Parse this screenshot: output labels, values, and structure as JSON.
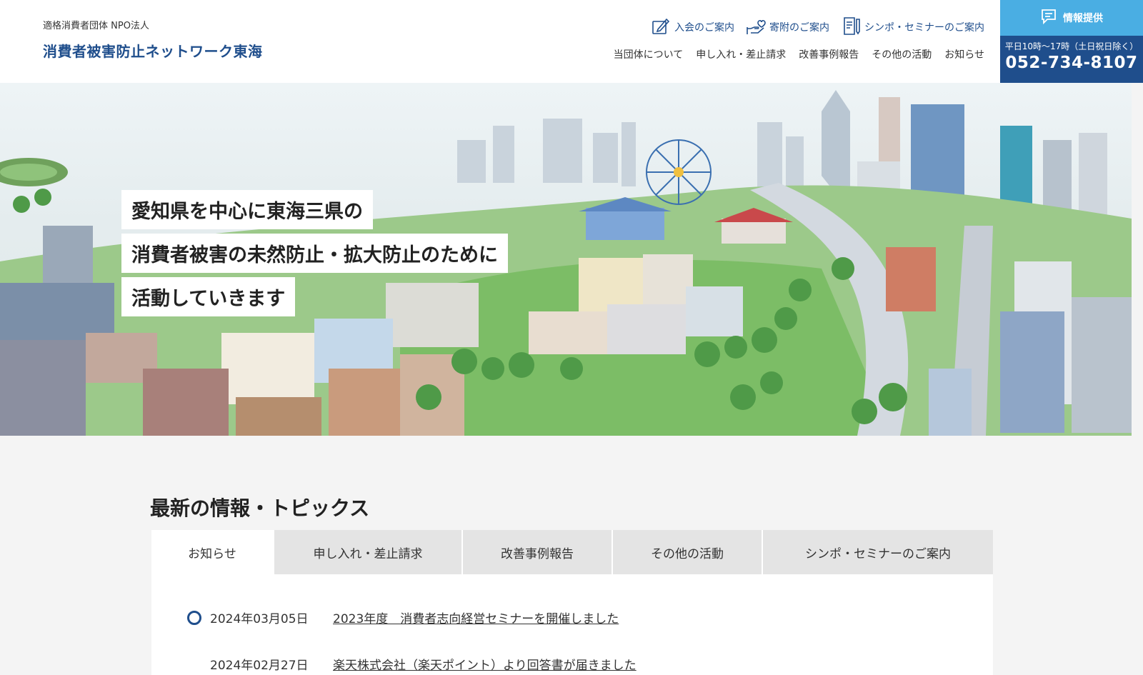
{
  "header": {
    "org_type": "適格消費者団体 NPO法人",
    "org_name": "消費者被害防止ネットワーク東海",
    "top_links": [
      {
        "label": "入会のご案内",
        "icon": "pen-form-icon"
      },
      {
        "label": "寄附のご案内",
        "icon": "heart-hand-icon"
      },
      {
        "label": "シンポ・セミナーのご案内",
        "icon": "document-icon"
      }
    ],
    "nav": [
      "当団体について",
      "申し入れ・差止請求",
      "改善事例報告",
      "その他の活動",
      "お知らせ"
    ],
    "info_box": {
      "label": "情報提供",
      "icon": "chat-bubble-icon",
      "hours": "平日10時～17時（土日祝日除く）",
      "phone": "052-734-8107"
    }
  },
  "hero": {
    "lines": [
      "愛知県を中心に東海三県の",
      "消費者被害の未然防止・拡大防止のために",
      "活動していきます"
    ]
  },
  "topics": {
    "title": "最新の情報・トピックス",
    "tabs": [
      "お知らせ",
      "申し入れ・差止請求",
      "改善事例報告",
      "その他の活動",
      "シンポ・セミナーのご案内"
    ],
    "items": [
      {
        "date": "2024年03月05日",
        "title": "2023年度　消費者志向経営セミナーを開催しました"
      },
      {
        "date": "2024年02月27日",
        "title": "楽天株式会社（楽天ポイント）より回答書が届きました"
      }
    ]
  },
  "colors": {
    "brand": "#1f4e8c",
    "info_accent": "#4aaee3",
    "tab_bg": "#e4e4e4"
  }
}
